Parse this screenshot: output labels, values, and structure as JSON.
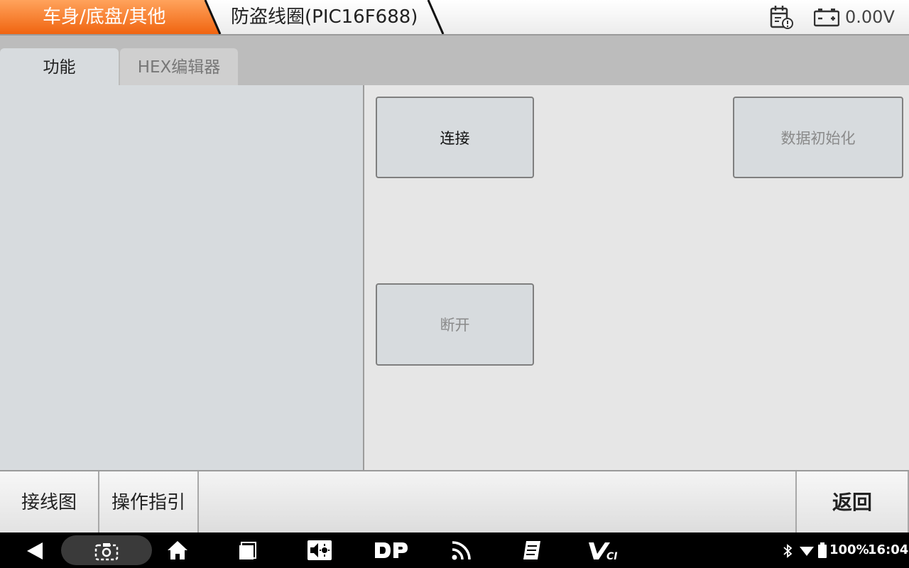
{
  "header": {
    "breadcrumb_active": "车身/底盘/其他",
    "breadcrumb_current": "防盗线圈(PIC16F688)",
    "voltage": "0.00V",
    "accent_color": "#f26b14"
  },
  "tabs": [
    {
      "label": "功能",
      "active": true
    },
    {
      "label": "HEX编辑器",
      "active": false
    }
  ],
  "functions": {
    "connect": "连接",
    "init_data": "数据初始化",
    "disconnect": "断开"
  },
  "toolbar": {
    "wiring": "接线图",
    "guide": "操作指引",
    "back": "返回"
  },
  "system_nav": {
    "icons": [
      "back-icon",
      "screenshot-icon",
      "home-icon",
      "recents-icon",
      "volume-brightness-icon",
      "dp-icon",
      "rss-icon",
      "notes-icon",
      "vci-icon"
    ],
    "battery": "100%",
    "time": "16:04"
  }
}
